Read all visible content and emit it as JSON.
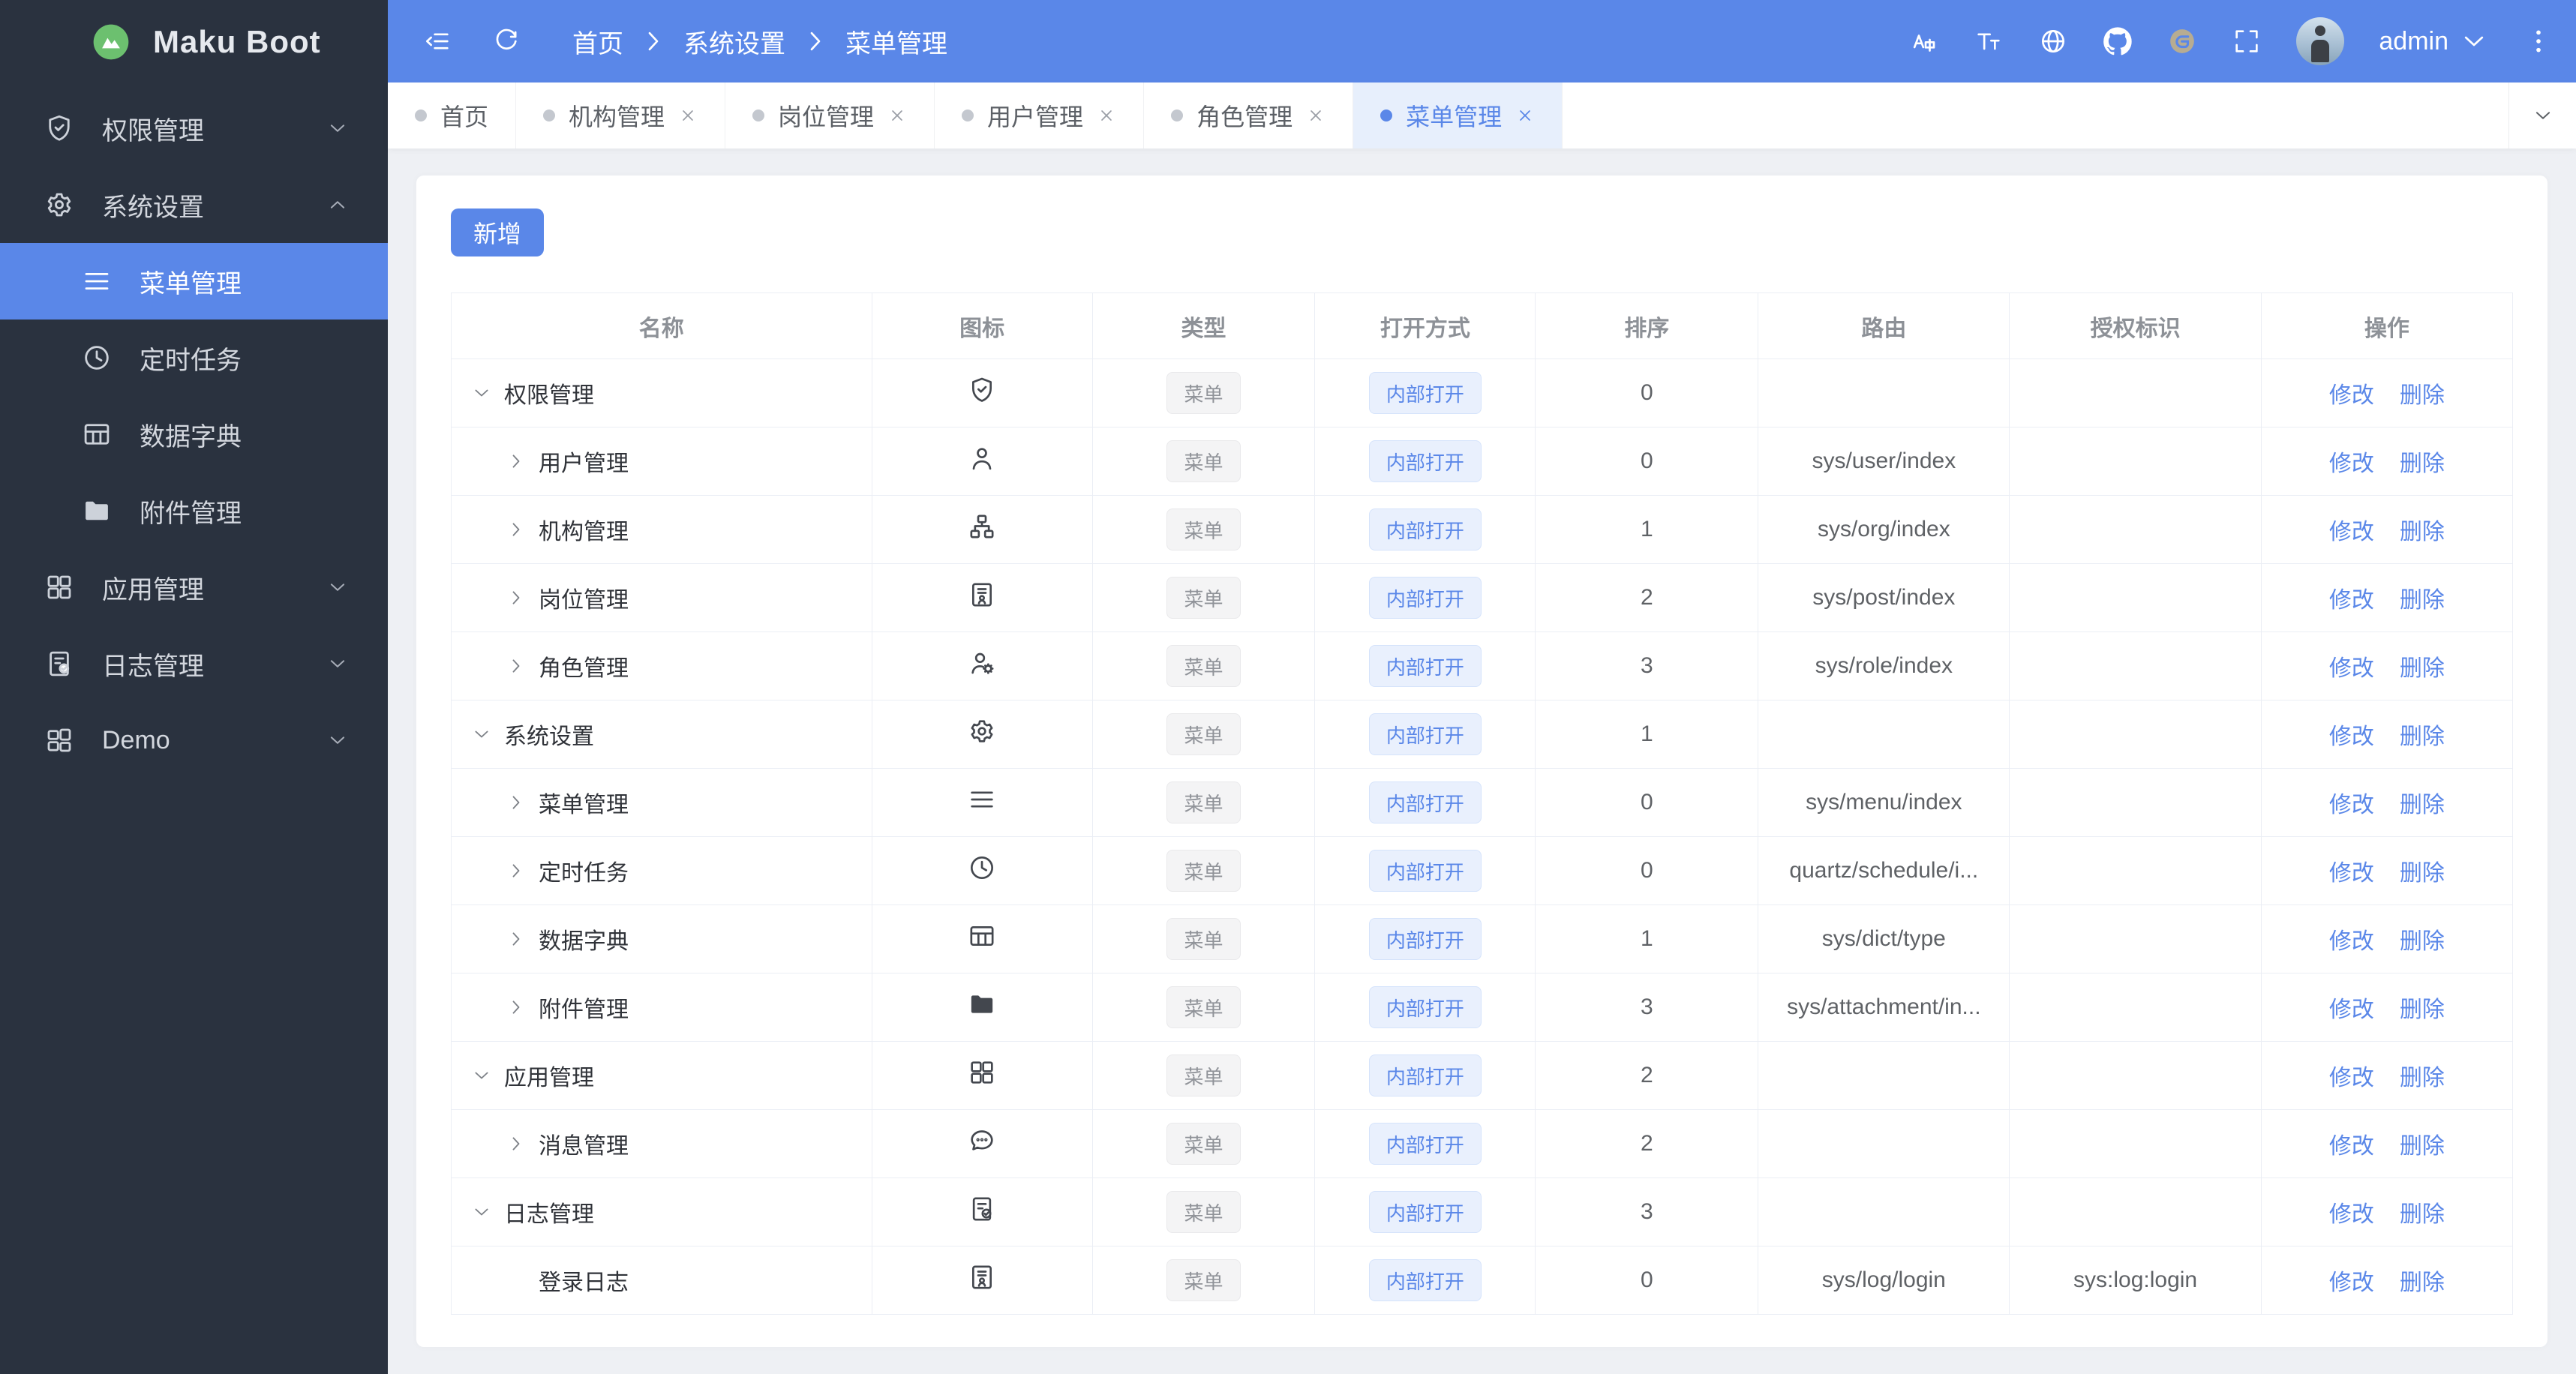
{
  "colors": {
    "accent": "#5a87e8",
    "sidebar_bg": "#2a323f",
    "content_bg": "#eef0f4",
    "active_tab_bg": "#e7effc",
    "logo_green": "#6cc06f",
    "tag_gray_text": "#909399"
  },
  "sidebar": {
    "logo_title": "Maku Boot",
    "items": [
      {
        "id": "permission",
        "label": "权限管理",
        "icon": "shield-check-icon",
        "chevron": "down"
      },
      {
        "id": "system",
        "label": "系统设置",
        "icon": "gear-icon",
        "chevron": "up",
        "expanded": true,
        "children": [
          {
            "id": "menu",
            "label": "菜单管理",
            "icon": "menu-lines-icon",
            "active": true
          },
          {
            "id": "schedule",
            "label": "定时任务",
            "icon": "clock-icon"
          },
          {
            "id": "dict",
            "label": "数据字典",
            "icon": "dict-table-icon"
          },
          {
            "id": "attachment",
            "label": "附件管理",
            "icon": "folder-icon"
          }
        ]
      },
      {
        "id": "app",
        "label": "应用管理",
        "icon": "grid-icon",
        "chevron": "down"
      },
      {
        "id": "log",
        "label": "日志管理",
        "icon": "log-doc-icon",
        "chevron": "down"
      },
      {
        "id": "demo",
        "label": "Demo",
        "icon": "grid-offset-icon",
        "chevron": "down"
      }
    ]
  },
  "topbar": {
    "left_icons": [
      {
        "id": "collapse-menu",
        "icon": "collapse-menu-icon"
      },
      {
        "id": "refresh",
        "icon": "refresh-icon"
      }
    ],
    "breadcrumb": [
      "首页",
      "系统设置",
      "菜单管理"
    ],
    "right_icons": [
      {
        "id": "translate",
        "icon": "translate-icon"
      },
      {
        "id": "font-size",
        "icon": "font-size-icon"
      },
      {
        "id": "language-globe",
        "icon": "globe-icon"
      },
      {
        "id": "github",
        "icon": "github-icon"
      },
      {
        "id": "gitee",
        "icon": "gitee-icon"
      },
      {
        "id": "fullscreen",
        "icon": "fullscreen-icon"
      }
    ],
    "username": "admin"
  },
  "tabs": [
    {
      "id": "home",
      "label": "首页",
      "closable": false
    },
    {
      "id": "org",
      "label": "机构管理",
      "closable": true
    },
    {
      "id": "post",
      "label": "岗位管理",
      "closable": true
    },
    {
      "id": "user",
      "label": "用户管理",
      "closable": true
    },
    {
      "id": "role",
      "label": "角色管理",
      "closable": true
    },
    {
      "id": "menu",
      "label": "菜单管理",
      "closable": true,
      "active": true
    }
  ],
  "content": {
    "add_button_label": "新增",
    "table": {
      "headers": [
        "名称",
        "图标",
        "类型",
        "打开方式",
        "排序",
        "路由",
        "授权标识",
        "操作"
      ],
      "col_widths": [
        "20.4%",
        "10.7%",
        "10.8%",
        "10.7%",
        "10.8%",
        "12.2%",
        "12.2%",
        "12.2%"
      ],
      "type_tag_label": "菜单",
      "open_tag_label": "内部打开",
      "edit_label": "修改",
      "delete_label": "删除",
      "rows": [
        {
          "name": "权限管理",
          "expand": "down",
          "indent": 0,
          "icon": "shield-check-icon",
          "sort": "0",
          "route": "",
          "auth": ""
        },
        {
          "name": "用户管理",
          "expand": "right",
          "indent": 1,
          "icon": "user-icon",
          "sort": "0",
          "route": "sys/user/index",
          "auth": ""
        },
        {
          "name": "机构管理",
          "expand": "right",
          "indent": 1,
          "icon": "org-icon",
          "sort": "1",
          "route": "sys/org/index",
          "auth": ""
        },
        {
          "name": "岗位管理",
          "expand": "right",
          "indent": 1,
          "icon": "badge-icon",
          "sort": "2",
          "route": "sys/post/index",
          "auth": ""
        },
        {
          "name": "角色管理",
          "expand": "right",
          "indent": 1,
          "icon": "user-gear-icon",
          "sort": "3",
          "route": "sys/role/index",
          "auth": ""
        },
        {
          "name": "系统设置",
          "expand": "down",
          "indent": 0,
          "icon": "gear-icon",
          "sort": "1",
          "route": "",
          "auth": ""
        },
        {
          "name": "菜单管理",
          "expand": "right",
          "indent": 1,
          "icon": "menu-lines-icon",
          "sort": "0",
          "route": "sys/menu/index",
          "auth": ""
        },
        {
          "name": "定时任务",
          "expand": "right",
          "indent": 1,
          "icon": "clock-icon",
          "sort": "0",
          "route": "quartz/schedule/i...",
          "auth": ""
        },
        {
          "name": "数据字典",
          "expand": "right",
          "indent": 1,
          "icon": "dict-table-icon",
          "sort": "1",
          "route": "sys/dict/type",
          "auth": ""
        },
        {
          "name": "附件管理",
          "expand": "right",
          "indent": 1,
          "icon": "folder-icon",
          "sort": "3",
          "route": "sys/attachment/in...",
          "auth": ""
        },
        {
          "name": "应用管理",
          "expand": "down",
          "indent": 0,
          "icon": "grid-icon",
          "sort": "2",
          "route": "",
          "auth": ""
        },
        {
          "name": "消息管理",
          "expand": "right",
          "indent": 1,
          "icon": "message-icon",
          "sort": "2",
          "route": "",
          "auth": ""
        },
        {
          "name": "日志管理",
          "expand": "down",
          "indent": 0,
          "icon": "log-doc-icon",
          "sort": "3",
          "route": "",
          "auth": ""
        },
        {
          "name": "登录日志",
          "expand": "none",
          "indent": 1,
          "icon": "badge-icon",
          "sort": "0",
          "route": "sys/log/login",
          "auth": "sys:log:login"
        }
      ]
    }
  }
}
